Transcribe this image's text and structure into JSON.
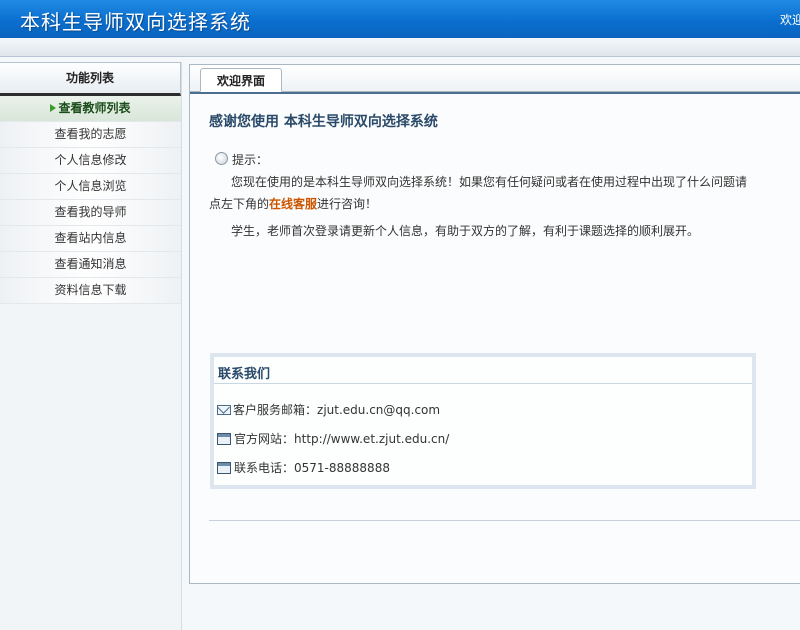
{
  "header": {
    "app_title": "本科生导师双向选择系统",
    "welcome_text": "欢迎"
  },
  "sidebar": {
    "title": "功能列表",
    "items": [
      {
        "label": "查看教师列表",
        "active": true
      },
      {
        "label": "查看我的志愿",
        "active": false
      },
      {
        "label": "个人信息修改",
        "active": false
      },
      {
        "label": "个人信息浏览",
        "active": false
      },
      {
        "label": "查看我的导师",
        "active": false
      },
      {
        "label": "查看站内信息",
        "active": false
      },
      {
        "label": "查看通知消息",
        "active": false
      },
      {
        "label": "资料信息下载",
        "active": false
      }
    ]
  },
  "main": {
    "tab_label": "欢迎界面",
    "heading": "感谢您使用  本科生导师双向选择系统",
    "tip_label": "提示：",
    "p1_line1": "您现在使用的是本科生导师双向选择系统！如果您有任何疑问或者在使用过程中出现了什么问题请",
    "p1_line2_pre": "点左下角的",
    "p1_link": "在线客服",
    "p1_line2_post": "进行咨询！",
    "p2": "学生，老师首次登录请更新个人信息，有助于双方的了解，有利于课题选择的顺利展开。"
  },
  "contact": {
    "title": "联系我们",
    "email_label": "客户服务邮箱：",
    "email_value": "zjut.edu.cn@qq.com",
    "website_label": "官方网站：",
    "website_value": "http://www.et.zjut.edu.cn/",
    "phone_label": "联系电话：",
    "phone_value": "0571-88888888"
  }
}
